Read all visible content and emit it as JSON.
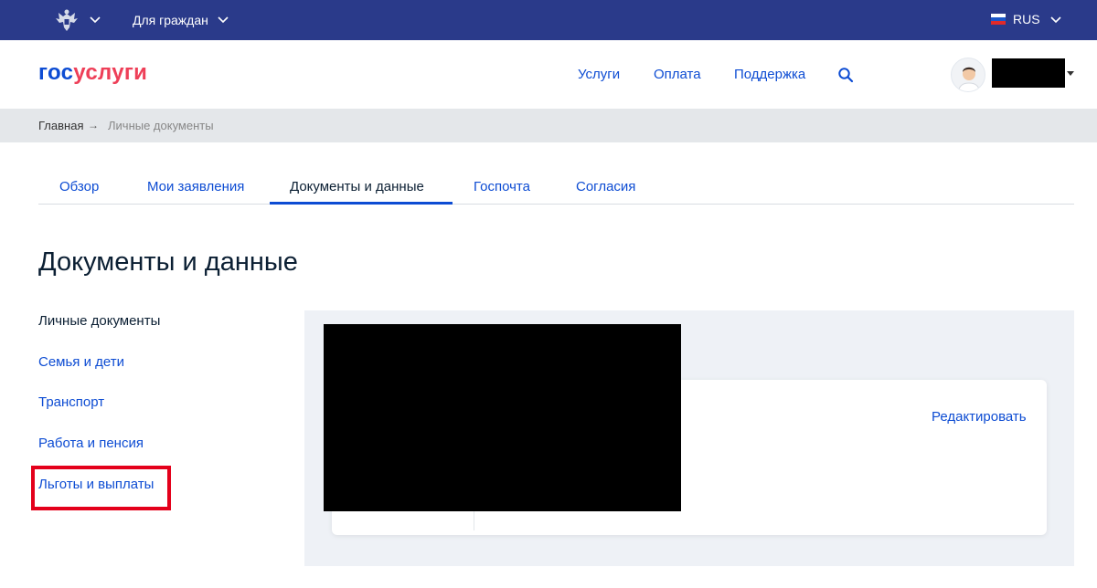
{
  "topbar": {
    "for_citizens": "Для граждан",
    "language": "RUS"
  },
  "header": {
    "logo_part1": "гос",
    "logo_part2": "услуги",
    "nav": [
      "Услуги",
      "Оплата",
      "Поддержка"
    ]
  },
  "breadcrumb": {
    "home": "Главная",
    "arrow": "→",
    "current": "Личные документы"
  },
  "tabs": [
    {
      "label": "Обзор",
      "active": false
    },
    {
      "label": "Мои заявления",
      "active": false
    },
    {
      "label": "Документы и данные",
      "active": true
    },
    {
      "label": "Госпочта",
      "active": false
    },
    {
      "label": "Согласия",
      "active": false
    }
  ],
  "page_title": "Документы и данные",
  "side_menu": [
    {
      "label": "Личные документы",
      "current": true
    },
    {
      "label": "Семья и дети",
      "current": false
    },
    {
      "label": "Транспорт",
      "current": false
    },
    {
      "label": "Работа и пенсия",
      "current": false
    },
    {
      "label": "Льготы и выплаты",
      "current": false,
      "highlighted": true
    }
  ],
  "card": {
    "edit_label": "Редактировать"
  },
  "colors": {
    "topbar": "#2a3a8a",
    "link": "#0d4cd3",
    "logo_red": "#ee3f58",
    "highlight": "#e4001b"
  }
}
